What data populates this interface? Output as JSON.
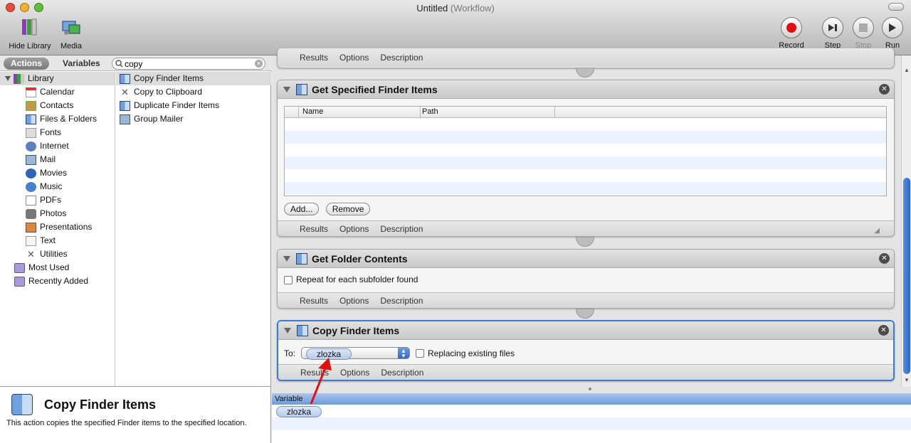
{
  "window": {
    "title": "Untitled",
    "subtitle": "(Workflow)"
  },
  "toolbar": {
    "hide_library": "Hide Library",
    "media": "Media",
    "record": "Record",
    "step": "Step",
    "stop": "Stop",
    "run": "Run"
  },
  "library": {
    "tabs": [
      "Actions",
      "Variables"
    ],
    "search_value": "copy",
    "root": "Library",
    "categories": [
      "Calendar",
      "Contacts",
      "Files & Folders",
      "Fonts",
      "Internet",
      "Mail",
      "Movies",
      "Music",
      "PDFs",
      "Photos",
      "Presentations",
      "Text",
      "Utilities"
    ],
    "extras": [
      "Most Used",
      "Recently Added"
    ],
    "results": [
      "Copy Finder Items",
      "Copy to Clipboard",
      "Duplicate Finder Items",
      "Group Mailer"
    ]
  },
  "description": {
    "title": "Copy Finder Items",
    "text": "This action copies the specified Finder items to the specified location."
  },
  "footer_tabs": [
    "Results",
    "Options",
    "Description"
  ],
  "actions": {
    "specified": {
      "title": "Get Specified Finder Items",
      "col_name": "Name",
      "col_path": "Path",
      "add": "Add...",
      "remove": "Remove"
    },
    "folder": {
      "title": "Get Folder Contents",
      "repeat": "Repeat for each subfolder found"
    },
    "copy": {
      "title": "Copy Finder Items",
      "to_label": "To:",
      "to_value": "zlozka",
      "replace": "Replacing existing files"
    }
  },
  "variables": {
    "header": "Variable",
    "items": [
      "zlozka"
    ]
  },
  "colors": {
    "selection": "#3d7bd6",
    "record": "#e01010",
    "arrow": "#e01010"
  }
}
